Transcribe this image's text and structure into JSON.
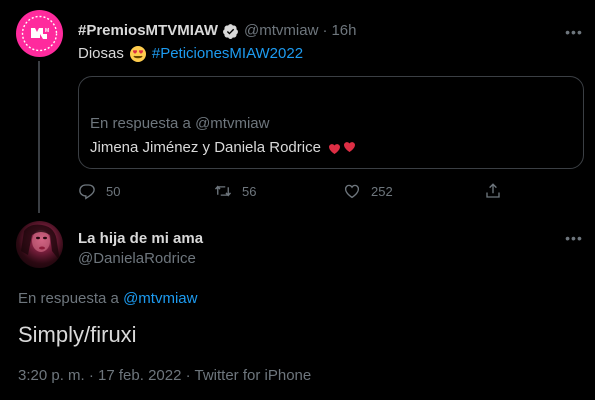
{
  "tweet1": {
    "display_name": "#PremiosMTVMIAW",
    "handle": "@mtvmiaw",
    "separator": "·",
    "time": "16h",
    "text_prefix": "Diosas",
    "hashtag": "#PeticionesMIAW2022",
    "quote": {
      "reply_prefix": "En respuesta a",
      "reply_handle": "@mtvmiaw",
      "text": "Jimena Jiménez y Daniela Rodrice"
    },
    "actions": {
      "replies": "50",
      "retweets": "56",
      "likes": "252"
    }
  },
  "tweet2": {
    "display_name": "La hija de mi ama",
    "handle": "@DanielaRodrice",
    "reply_prefix": "En respuesta a",
    "reply_handle": "@mtvmiaw",
    "text": "Simply/firuxi",
    "meta": "3:20 p. m. · 17 feb. 2022 · Twitter for iPhone"
  },
  "colors": {
    "background": "#000000",
    "text": "#d9d9d9",
    "muted": "#6e767d",
    "link": "#1d9bf0",
    "mtv_pink": "#ff2a9d",
    "verified": "#d9d9d9"
  },
  "icons": [
    "mtv-logo-icon",
    "verified-badge-icon",
    "more-icon",
    "heart-eyes-emoji-icon",
    "two-hearts-emoji-icon",
    "reply-icon",
    "retweet-icon",
    "like-icon",
    "share-icon"
  ]
}
